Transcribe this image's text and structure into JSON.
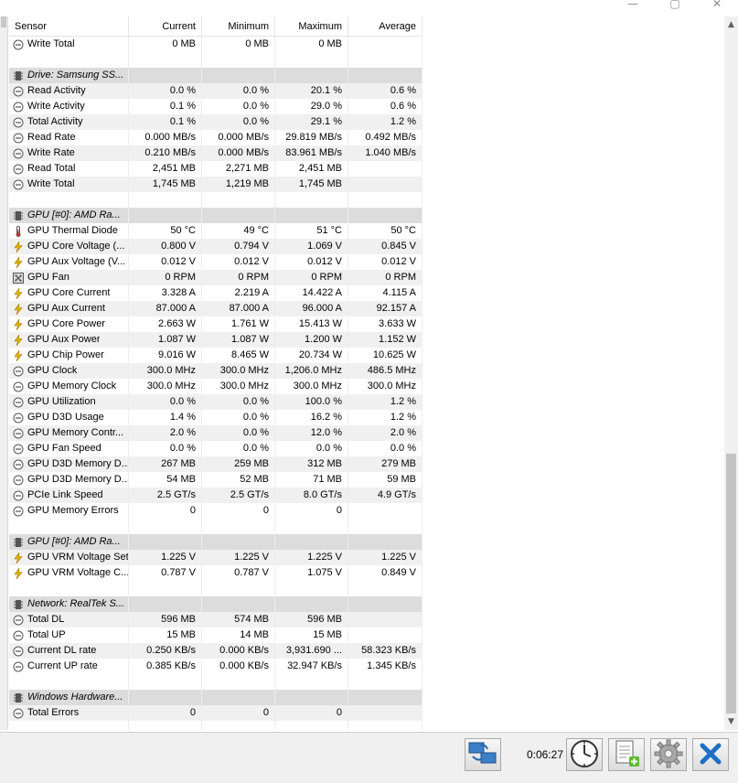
{
  "window": {
    "minimize_glyph": "—",
    "maximize_glyph": "▢",
    "close_glyph": "✕"
  },
  "columns": [
    "Sensor",
    "Current",
    "Minimum",
    "Maximum",
    "Average"
  ],
  "rows": [
    {
      "kind": "sensor",
      "icon": "clock-gauge-icon",
      "label": "Write Total",
      "values": [
        "0 MB",
        "0 MB",
        "0 MB",
        ""
      ]
    },
    {
      "kind": "blank"
    },
    {
      "kind": "group",
      "icon": "chip-icon",
      "label": "Drive: Samsung SS..."
    },
    {
      "kind": "sensor",
      "icon": "clock-gauge-icon",
      "label": "Read Activity",
      "values": [
        "0.0 %",
        "0.0 %",
        "20.1 %",
        "0.6 %"
      ]
    },
    {
      "kind": "sensor",
      "icon": "clock-gauge-icon",
      "label": "Write Activity",
      "values": [
        "0.1 %",
        "0.0 %",
        "29.0 %",
        "0.6 %"
      ]
    },
    {
      "kind": "sensor",
      "icon": "clock-gauge-icon",
      "label": "Total Activity",
      "values": [
        "0.1 %",
        "0.0 %",
        "29.1 %",
        "1.2 %"
      ]
    },
    {
      "kind": "sensor",
      "icon": "clock-gauge-icon",
      "label": "Read Rate",
      "values": [
        "0.000 MB/s",
        "0.000 MB/s",
        "29.819 MB/s",
        "0.492 MB/s"
      ]
    },
    {
      "kind": "sensor",
      "icon": "clock-gauge-icon",
      "label": "Write Rate",
      "values": [
        "0.210 MB/s",
        "0.000 MB/s",
        "83.961 MB/s",
        "1.040 MB/s"
      ]
    },
    {
      "kind": "sensor",
      "icon": "clock-gauge-icon",
      "label": "Read Total",
      "values": [
        "2,451 MB",
        "2,271 MB",
        "2,451 MB",
        ""
      ]
    },
    {
      "kind": "sensor",
      "icon": "clock-gauge-icon",
      "label": "Write Total",
      "values": [
        "1,745 MB",
        "1,219 MB",
        "1,745 MB",
        ""
      ]
    },
    {
      "kind": "blank"
    },
    {
      "kind": "group",
      "icon": "chip-icon",
      "label": "GPU [#0]: AMD Ra..."
    },
    {
      "kind": "sensor",
      "icon": "thermometer-icon",
      "label": "GPU Thermal Diode",
      "values": [
        "50 °C",
        "49 °C",
        "51 °C",
        "50 °C"
      ]
    },
    {
      "kind": "sensor",
      "icon": "lightning-icon",
      "label": "GPU Core Voltage (...",
      "values": [
        "0.800 V",
        "0.794 V",
        "1.069 V",
        "0.845 V"
      ]
    },
    {
      "kind": "sensor",
      "icon": "lightning-icon",
      "label": "GPU Aux Voltage (V...",
      "values": [
        "0.012 V",
        "0.012 V",
        "0.012 V",
        "0.012 V"
      ]
    },
    {
      "kind": "sensor",
      "icon": "fan-icon",
      "label": "GPU Fan",
      "values": [
        "0 RPM",
        "0 RPM",
        "0 RPM",
        "0 RPM"
      ]
    },
    {
      "kind": "sensor",
      "icon": "lightning-icon",
      "label": "GPU Core Current",
      "values": [
        "3.328 A",
        "2.219 A",
        "14.422 A",
        "4.115 A"
      ]
    },
    {
      "kind": "sensor",
      "icon": "lightning-icon",
      "label": "GPU Aux Current",
      "values": [
        "87.000 A",
        "87.000 A",
        "96.000 A",
        "92.157 A"
      ]
    },
    {
      "kind": "sensor",
      "icon": "lightning-icon",
      "label": "GPU Core Power",
      "values": [
        "2.663 W",
        "1.761 W",
        "15.413 W",
        "3.633 W"
      ]
    },
    {
      "kind": "sensor",
      "icon": "lightning-icon",
      "label": "GPU Aux Power",
      "values": [
        "1.087 W",
        "1.087 W",
        "1.200 W",
        "1.152 W"
      ]
    },
    {
      "kind": "sensor",
      "icon": "lightning-icon",
      "label": "GPU Chip Power",
      "values": [
        "9.016 W",
        "8.465 W",
        "20.734 W",
        "10.625 W"
      ]
    },
    {
      "kind": "sensor",
      "icon": "clock-gauge-icon",
      "label": "GPU Clock",
      "values": [
        "300.0 MHz",
        "300.0 MHz",
        "1,206.0 MHz",
        "486.5 MHz"
      ]
    },
    {
      "kind": "sensor",
      "icon": "clock-gauge-icon",
      "label": "GPU Memory Clock",
      "values": [
        "300.0 MHz",
        "300.0 MHz",
        "300.0 MHz",
        "300.0 MHz"
      ]
    },
    {
      "kind": "sensor",
      "icon": "clock-gauge-icon",
      "label": "GPU Utilization",
      "values": [
        "0.0 %",
        "0.0 %",
        "100.0 %",
        "1.2 %"
      ]
    },
    {
      "kind": "sensor",
      "icon": "clock-gauge-icon",
      "label": "GPU D3D Usage",
      "values": [
        "1.4 %",
        "0.0 %",
        "16.2 %",
        "1.2 %"
      ]
    },
    {
      "kind": "sensor",
      "icon": "clock-gauge-icon",
      "label": "GPU Memory Contr...",
      "values": [
        "2.0 %",
        "0.0 %",
        "12.0 %",
        "2.0 %"
      ]
    },
    {
      "kind": "sensor",
      "icon": "clock-gauge-icon",
      "label": "GPU Fan Speed",
      "values": [
        "0.0 %",
        "0.0 %",
        "0.0 %",
        "0.0 %"
      ]
    },
    {
      "kind": "sensor",
      "icon": "clock-gauge-icon",
      "label": "GPU D3D Memory D...",
      "values": [
        "267 MB",
        "259 MB",
        "312 MB",
        "279 MB"
      ]
    },
    {
      "kind": "sensor",
      "icon": "clock-gauge-icon",
      "label": "GPU D3D Memory D...",
      "values": [
        "54 MB",
        "52 MB",
        "71 MB",
        "59 MB"
      ]
    },
    {
      "kind": "sensor",
      "icon": "clock-gauge-icon",
      "label": "PCIe Link Speed",
      "values": [
        "2.5 GT/s",
        "2.5 GT/s",
        "8.0 GT/s",
        "4.9 GT/s"
      ]
    },
    {
      "kind": "sensor",
      "icon": "clock-gauge-icon",
      "label": "GPU Memory Errors",
      "values": [
        "0",
        "0",
        "0",
        ""
      ]
    },
    {
      "kind": "blank"
    },
    {
      "kind": "group",
      "icon": "chip-icon",
      "label": "GPU [#0]: AMD Ra..."
    },
    {
      "kind": "sensor",
      "icon": "lightning-icon",
      "label": "GPU VRM Voltage Set",
      "values": [
        "1.225 V",
        "1.225 V",
        "1.225 V",
        "1.225 V"
      ]
    },
    {
      "kind": "sensor",
      "icon": "lightning-icon",
      "label": "GPU VRM Voltage C...",
      "values": [
        "0.787 V",
        "0.787 V",
        "1.075 V",
        "0.849 V"
      ]
    },
    {
      "kind": "blank"
    },
    {
      "kind": "group",
      "icon": "chip-icon",
      "label": "Network: RealTek S..."
    },
    {
      "kind": "sensor",
      "icon": "clock-gauge-icon",
      "label": "Total DL",
      "values": [
        "596 MB",
        "574 MB",
        "596 MB",
        ""
      ]
    },
    {
      "kind": "sensor",
      "icon": "clock-gauge-icon",
      "label": "Total UP",
      "values": [
        "15 MB",
        "14 MB",
        "15 MB",
        ""
      ]
    },
    {
      "kind": "sensor",
      "icon": "clock-gauge-icon",
      "label": "Current DL rate",
      "values": [
        "0.250 KB/s",
        "0.000 KB/s",
        "3,931.690 ...",
        "58.323 KB/s"
      ]
    },
    {
      "kind": "sensor",
      "icon": "clock-gauge-icon",
      "label": "Current UP rate",
      "values": [
        "0.385 KB/s",
        "0.000 KB/s",
        "32.947 KB/s",
        "1.345 KB/s"
      ]
    },
    {
      "kind": "blank"
    },
    {
      "kind": "group",
      "icon": "chip-icon",
      "label": "Windows Hardware..."
    },
    {
      "kind": "sensor",
      "icon": "clock-gauge-icon",
      "label": "Total Errors",
      "values": [
        "0",
        "0",
        "0",
        ""
      ]
    },
    {
      "kind": "blank"
    }
  ],
  "scrollbar": {
    "up_arrow": "▲",
    "down_arrow": "▼"
  },
  "toolbar": {
    "elapsed_time": "0:06:27",
    "buttons": [
      {
        "name": "network-monitor-button",
        "icon": "network-computers-icon"
      },
      {
        "name": "clock-reset-button",
        "icon": "clock-icon"
      },
      {
        "name": "report-button",
        "icon": "document-add-icon"
      },
      {
        "name": "settings-button",
        "icon": "gear-icon"
      },
      {
        "name": "close-button",
        "icon": "close-x-icon"
      }
    ]
  },
  "colors": {
    "row_alt": "#f0f0f0",
    "group_row": "#dcdcdc",
    "lightning": "#e3b100",
    "close_x": "#1d6fc4"
  }
}
